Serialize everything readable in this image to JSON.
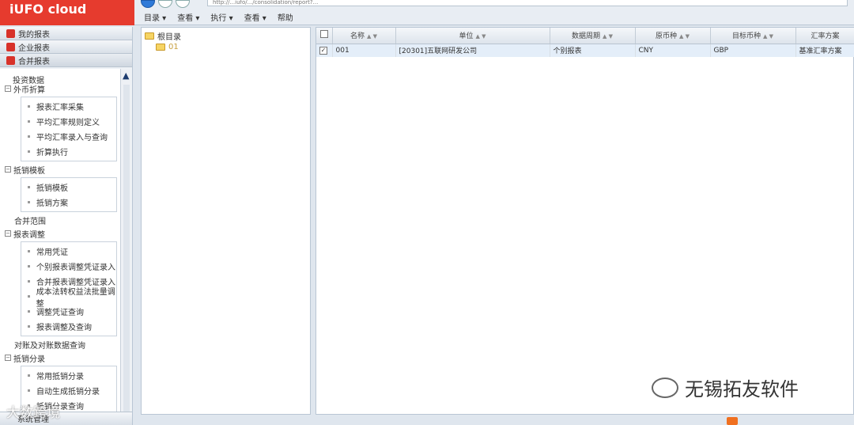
{
  "app": {
    "logo": "iUFO cloud"
  },
  "browser": {
    "url": "http://...iufo/.../consolidation/report?..."
  },
  "menubar": [
    {
      "label": "目录 ▾"
    },
    {
      "label": "查看 ▾"
    },
    {
      "label": "执行 ▾"
    },
    {
      "label": "查看 ▾"
    },
    {
      "label": "帮助"
    }
  ],
  "sidebar": {
    "sections": [
      {
        "label": "我的报表"
      },
      {
        "label": "企业报表"
      },
      {
        "label": "合并报表"
      }
    ],
    "tree": {
      "root": "投资数据",
      "groups": [
        {
          "label": "外币折算",
          "items": [
            "报表汇率采集",
            "平均汇率规则定义",
            "平均汇率录入与查询",
            "折算执行"
          ]
        },
        {
          "label": "抵销模板",
          "items": [
            "抵销模板",
            "抵销方案"
          ]
        }
      ],
      "plain_1": "合并范围",
      "groups2": [
        {
          "label": "报表调整",
          "items": [
            "常用凭证",
            "个别报表调整凭证录入",
            "合并报表调整凭证录入",
            "成本法转权益法批量调整",
            "调整凭证查询",
            "报表调整及查询"
          ]
        }
      ],
      "plain_2": "对账及对账数据查询",
      "groups3": [
        {
          "label": "抵销分录",
          "items": [
            "常用抵销分录",
            "自动生成抵销分录",
            "抵销分录查询"
          ]
        }
      ]
    },
    "bottom_label": "系统管理"
  },
  "midtree": {
    "root": "根目录",
    "child": "01"
  },
  "grid": {
    "columns": [
      "",
      "名称",
      "单位",
      "数据周期",
      "原币种",
      "目标币种",
      "汇率方案"
    ],
    "rows": [
      {
        "checked": "✓",
        "name": "001",
        "unit": "[20301]五联网研发公司",
        "period": "个别报表",
        "src": "CNY",
        "tgt": "GBP",
        "scheme": "基准汇率方案"
      }
    ]
  },
  "watermark": {
    "right": "无锡拓友软件",
    "left": "大数跨境"
  }
}
